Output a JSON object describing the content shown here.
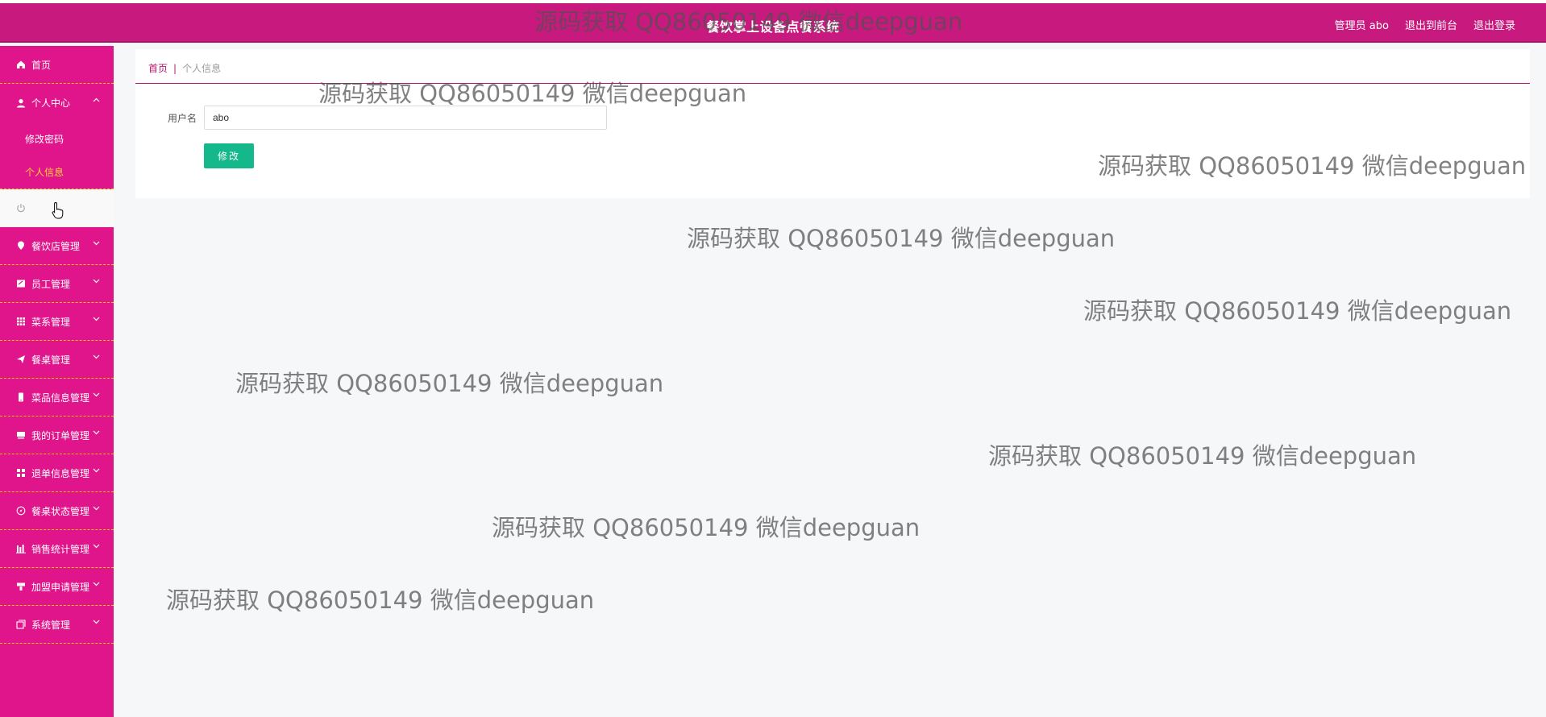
{
  "header": {
    "title": "餐饮掌上设备点餐系统",
    "admin_label": "管理员 abo",
    "links": [
      "退出到前台",
      "退出登录"
    ]
  },
  "sidebar": {
    "items": [
      {
        "label": "首页",
        "icon": "home-icon"
      },
      {
        "label": "个人中心",
        "icon": "user-icon",
        "expanded": true,
        "children": [
          {
            "label": "修改密码"
          },
          {
            "label": "个人信息",
            "active": true
          }
        ]
      },
      {
        "label": "",
        "icon": "power-icon"
      },
      {
        "label": "餐饮店管理",
        "icon": "location-pin-icon"
      },
      {
        "label": "员工管理",
        "icon": "edit-box-icon"
      },
      {
        "label": "菜系管理",
        "icon": "grid-icon"
      },
      {
        "label": "餐桌管理",
        "icon": "send-icon"
      },
      {
        "label": "菜品信息管理",
        "icon": "mobile-icon"
      },
      {
        "label": "我的订单管理",
        "icon": "cart-icon"
      },
      {
        "label": "退单信息管理",
        "icon": "apps-icon"
      },
      {
        "label": "餐桌状态管理",
        "icon": "compass-icon"
      },
      {
        "label": "销售统计管理",
        "icon": "bar-chart-icon"
      },
      {
        "label": "加盟申请管理",
        "icon": "cup-icon"
      },
      {
        "label": "系统管理",
        "icon": "layers-icon"
      }
    ]
  },
  "breadcrumb": {
    "home": "首页",
    "sep": "|",
    "current": "个人信息"
  },
  "form": {
    "username_label": "用户名",
    "username_value": "abo",
    "submit_label": "修改"
  },
  "watermark_text": "源码获取 QQ86050149 微信deepguan",
  "colors": {
    "primary": "#e0148b",
    "header": "#c8197e",
    "button": "#14b88a",
    "active_sub": "#ffd23a"
  }
}
